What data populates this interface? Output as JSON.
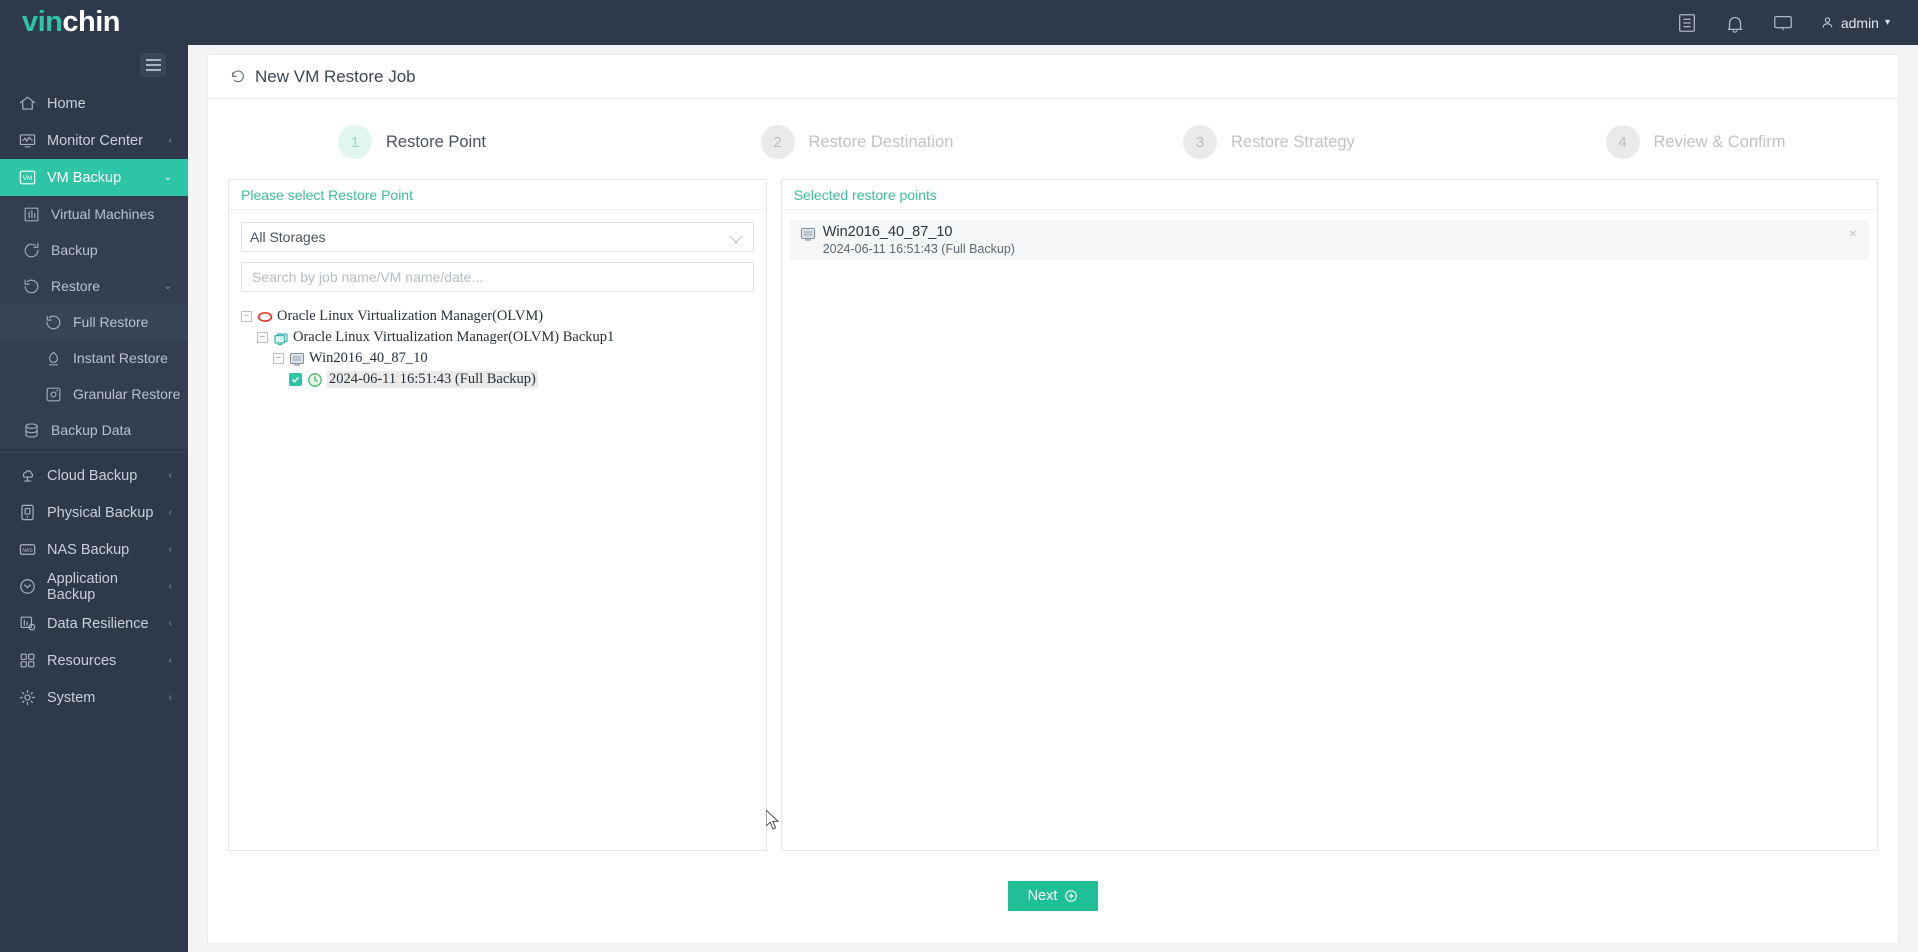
{
  "app": {
    "logo_part1": "vin",
    "logo_part2": "chin",
    "user": "admin"
  },
  "header_icons": [
    {
      "name": "log-icon",
      "glyph": "list"
    },
    {
      "name": "bell-icon",
      "glyph": "bell"
    },
    {
      "name": "monitor-icon",
      "glyph": "monitor"
    }
  ],
  "sidebar": {
    "items": [
      {
        "label": "Home",
        "icon": "home-icon",
        "level": 0,
        "chevron": "",
        "state": "normal"
      },
      {
        "label": "Monitor Center",
        "icon": "monitor-center-icon",
        "level": 0,
        "chevron": "‹",
        "state": "normal"
      },
      {
        "label": "VM Backup",
        "icon": "vm-backup-icon",
        "level": 0,
        "chevron": "⌄",
        "state": "active"
      },
      {
        "label": "Virtual Machines",
        "icon": "virtual-machines-icon",
        "level": 1,
        "chevron": "",
        "state": "normal"
      },
      {
        "label": "Backup",
        "icon": "backup-icon",
        "level": 1,
        "chevron": "",
        "state": "normal"
      },
      {
        "label": "Restore",
        "icon": "restore-icon",
        "level": 1,
        "chevron": "⌄",
        "state": "normal"
      },
      {
        "label": "Full Restore",
        "icon": "full-restore-icon",
        "level": 2,
        "chevron": "",
        "state": "selected"
      },
      {
        "label": "Instant Restore",
        "icon": "instant-restore-icon",
        "level": 2,
        "chevron": "",
        "state": "normal"
      },
      {
        "label": "Granular Restore",
        "icon": "granular-restore-icon",
        "level": 2,
        "chevron": "",
        "state": "normal"
      },
      {
        "label": "Backup Data",
        "icon": "backup-data-icon",
        "level": 1,
        "chevron": "",
        "state": "normal"
      },
      {
        "label": "Cloud Backup",
        "icon": "cloud-backup-icon",
        "level": 0,
        "chevron": "‹",
        "state": "normal"
      },
      {
        "label": "Physical Backup",
        "icon": "physical-backup-icon",
        "level": 0,
        "chevron": "‹",
        "state": "normal"
      },
      {
        "label": "NAS Backup",
        "icon": "nas-backup-icon",
        "level": 0,
        "chevron": "‹",
        "state": "normal"
      },
      {
        "label": "Application Backup",
        "icon": "application-backup-icon",
        "level": 0,
        "chevron": "‹",
        "state": "normal"
      },
      {
        "label": "Data Resilience",
        "icon": "data-resilience-icon",
        "level": 0,
        "chevron": "‹",
        "state": "normal"
      },
      {
        "label": "Resources",
        "icon": "resources-icon",
        "level": 0,
        "chevron": "‹",
        "state": "normal"
      },
      {
        "label": "System",
        "icon": "system-icon",
        "level": 0,
        "chevron": "‹",
        "state": "normal"
      }
    ]
  },
  "page": {
    "title": "New VM Restore Job",
    "title_icon": "restore-circular-arrow-icon"
  },
  "stepper": {
    "steps": [
      {
        "num": "1",
        "label": "Restore Point",
        "active": true
      },
      {
        "num": "2",
        "label": "Restore Destination",
        "active": false
      },
      {
        "num": "3",
        "label": "Restore Strategy",
        "active": false
      },
      {
        "num": "4",
        "label": "Review & Confirm",
        "active": false
      }
    ]
  },
  "left_panel": {
    "header": "Please select Restore Point",
    "storage_selected": "All Storages",
    "storage_options": [
      "All Storages"
    ],
    "search_placeholder": "Search by job name/VM name/date...",
    "search_value": "",
    "tree": [
      {
        "label": "Oracle Linux Virtualization Manager(OLVM)",
        "level": 0,
        "icon": "olvm-ring-icon",
        "expanded": true,
        "checkbox": false,
        "selected": false
      },
      {
        "label": "Oracle Linux Virtualization Manager(OLVM) Backup1",
        "level": 1,
        "icon": "backup-job-icon",
        "expanded": true,
        "checkbox": false,
        "selected": false
      },
      {
        "label": "Win2016_40_87_10",
        "level": 2,
        "icon": "vm-icon",
        "expanded": true,
        "checkbox": false,
        "selected": false
      },
      {
        "label": "2024-06-11 16:51:43 (Full  Backup)",
        "level": 3,
        "icon": "clock-icon",
        "expanded": false,
        "checkbox": true,
        "selected": true
      }
    ]
  },
  "right_panel": {
    "header": "Selected restore points",
    "items": [
      {
        "name": "Win2016_40_87_10",
        "detail": "2024-06-11 16:51:43 (Full Backup)",
        "icon": "vm-icon",
        "remove": "×"
      }
    ]
  },
  "footer": {
    "next_label": "Next"
  },
  "colors": {
    "brand_teal": "#2ec4a6",
    "sidebar_bg": "#2e3a4b",
    "next_button": "#1fbf97",
    "panel_header_text": "#3dbb9e"
  }
}
